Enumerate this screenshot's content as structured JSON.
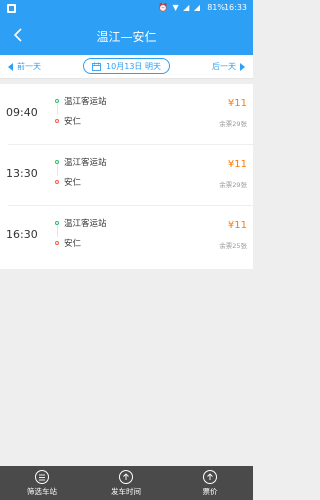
{
  "statusbar": {
    "icons": "⏰ ▼ ◢ ◢",
    "battery": "81%",
    "time": "16:33"
  },
  "header": {
    "title": "温江—安仁"
  },
  "datebar": {
    "prev": "前一天",
    "date": "10月13日 明天",
    "next": "后一天"
  },
  "trips": [
    {
      "time": "09:40",
      "from": "温江客运站",
      "to": "安仁",
      "price": "¥11",
      "seats": "余票29张"
    },
    {
      "time": "13:30",
      "from": "温江客运站",
      "to": "安仁",
      "price": "¥11",
      "seats": "余票29张"
    },
    {
      "time": "16:30",
      "from": "温江客运站",
      "to": "安仁",
      "price": "¥11",
      "seats": "余票25张"
    }
  ],
  "bottom": {
    "tabs": [
      {
        "label": "筛选车站",
        "icon": "filter-icon"
      },
      {
        "label": "发车时间",
        "icon": "arrow-up-icon"
      },
      {
        "label": "票价",
        "icon": "arrow-up-icon"
      }
    ]
  },
  "colors": {
    "primary": "#2d9ff5",
    "price": "#ff7a00",
    "bottom": "#4a4a4a"
  }
}
